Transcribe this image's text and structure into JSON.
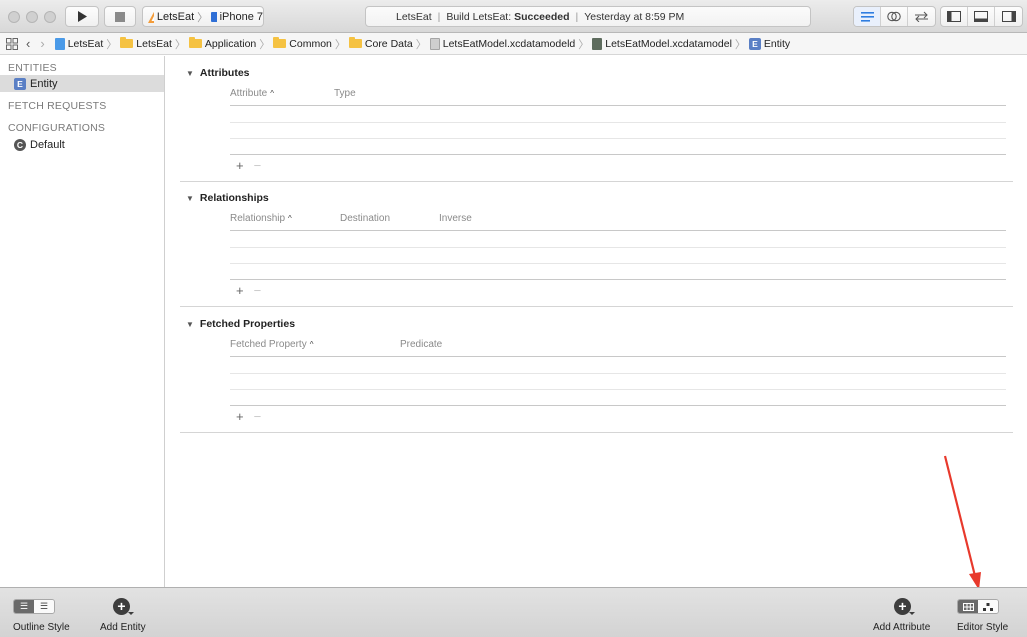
{
  "toolbar": {
    "scheme_project": "LetsEat",
    "scheme_device": "iPhone 7",
    "status_project": "LetsEat",
    "status_build_prefix": "Build LetsEat:",
    "status_build_result": "Succeeded",
    "status_time": "Yesterday at 8:59 PM"
  },
  "jumpbar": {
    "crumbs": [
      "LetsEat",
      "LetsEat",
      "Application",
      "Common",
      "Core Data",
      "LetsEatModel.xcdatamodeld",
      "LetsEatModel.xcdatamodel",
      "Entity"
    ]
  },
  "sidebar": {
    "entities_header": "ENTITIES",
    "entity_item": "Entity",
    "entity_badge": "E",
    "fetch_header": "FETCH REQUESTS",
    "config_header": "CONFIGURATIONS",
    "config_item": "Default",
    "config_badge": "C"
  },
  "editor": {
    "attributes": {
      "title": "Attributes",
      "columns": [
        "Attribute",
        "Type"
      ]
    },
    "relationships": {
      "title": "Relationships",
      "columns": [
        "Relationship",
        "Destination",
        "Inverse"
      ]
    },
    "fetched": {
      "title": "Fetched Properties",
      "columns": [
        "Fetched Property",
        "Predicate"
      ]
    },
    "add_symbol": "+",
    "remove_symbol": "−"
  },
  "bottombar": {
    "outline_style": "Outline Style",
    "add_entity": "Add Entity",
    "add_attribute": "Add Attribute",
    "editor_style": "Editor Style"
  },
  "annotation": {
    "color": "#e8392c"
  }
}
